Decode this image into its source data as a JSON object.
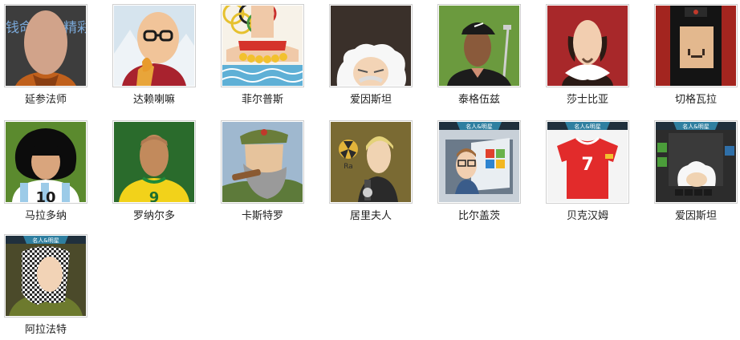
{
  "gallery": {
    "items": [
      {
        "name": "延参法师",
        "icon": "monk-portrait-icon",
        "banner": "",
        "bg_text": [
          "钱",
          "命",
          "精",
          "彩"
        ]
      },
      {
        "name": "达赖喇嘛",
        "icon": "dalai-lama-portrait-icon",
        "banner": ""
      },
      {
        "name": "菲尔普斯",
        "icon": "swimmer-portrait-icon",
        "banner": ""
      },
      {
        "name": "爱因斯坦",
        "icon": "einstein-portrait-icon",
        "banner": ""
      },
      {
        "name": "泰格伍兹",
        "icon": "golfer-portrait-icon",
        "banner": ""
      },
      {
        "name": "莎士比亚",
        "icon": "shakespeare-portrait-icon",
        "banner": ""
      },
      {
        "name": "切格瓦拉",
        "icon": "che-guevara-portrait-icon",
        "banner": ""
      },
      {
        "name": "马拉多纳",
        "icon": "maradona-portrait-icon",
        "banner": "",
        "jersey_number": "10"
      },
      {
        "name": "罗纳尔多",
        "icon": "ronaldo-portrait-icon",
        "banner": "",
        "jersey_number": "9"
      },
      {
        "name": "卡斯特罗",
        "icon": "castro-portrait-icon",
        "banner": ""
      },
      {
        "name": "居里夫人",
        "icon": "curie-portrait-icon",
        "banner": "",
        "element_symbol": "Ra"
      },
      {
        "name": "比尔盖茨",
        "icon": "gates-portrait-icon",
        "banner": "名人&明星"
      },
      {
        "name": "贝克汉姆",
        "icon": "beckham-portrait-icon",
        "banner": "名人&明星",
        "jersey_number": "7"
      },
      {
        "name": "爱因斯坦",
        "icon": "einstein-game-portrait-icon",
        "banner": "名人&明星"
      },
      {
        "name": "阿拉法特",
        "icon": "arafat-portrait-icon",
        "banner": "名人&明星"
      }
    ]
  }
}
